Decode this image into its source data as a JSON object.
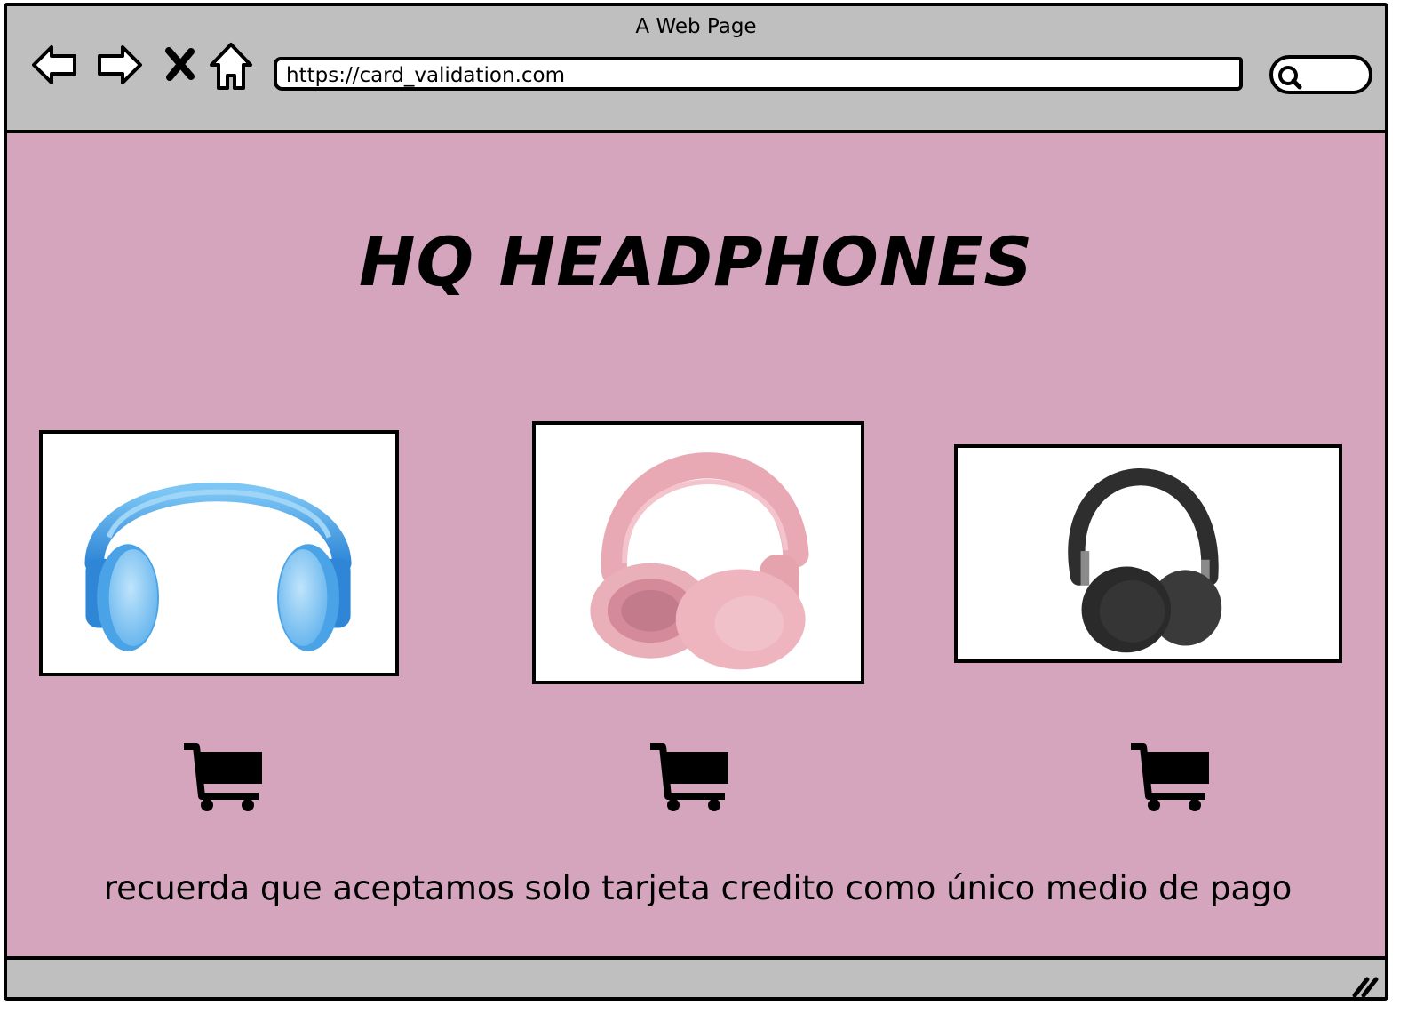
{
  "window": {
    "title": "A Web Page",
    "url": "https://card_validation.com"
  },
  "page": {
    "heading": "HQ HEADPHONES",
    "products": [
      {
        "name": "blue-headphones",
        "color": "#4aa3e6"
      },
      {
        "name": "pink-headphones",
        "color": "#e9a9b3"
      },
      {
        "name": "black-headphones",
        "color": "#2e2e2e"
      }
    ],
    "note": "recuerda que aceptamos solo tarjeta credito como único medio de pago"
  },
  "colors": {
    "background": "#d5a5be",
    "chrome": "#bfbfbf"
  },
  "icons": [
    "back-icon",
    "forward-icon",
    "close-icon",
    "home-icon",
    "search-icon",
    "cart-icon",
    "resize-icon"
  ]
}
